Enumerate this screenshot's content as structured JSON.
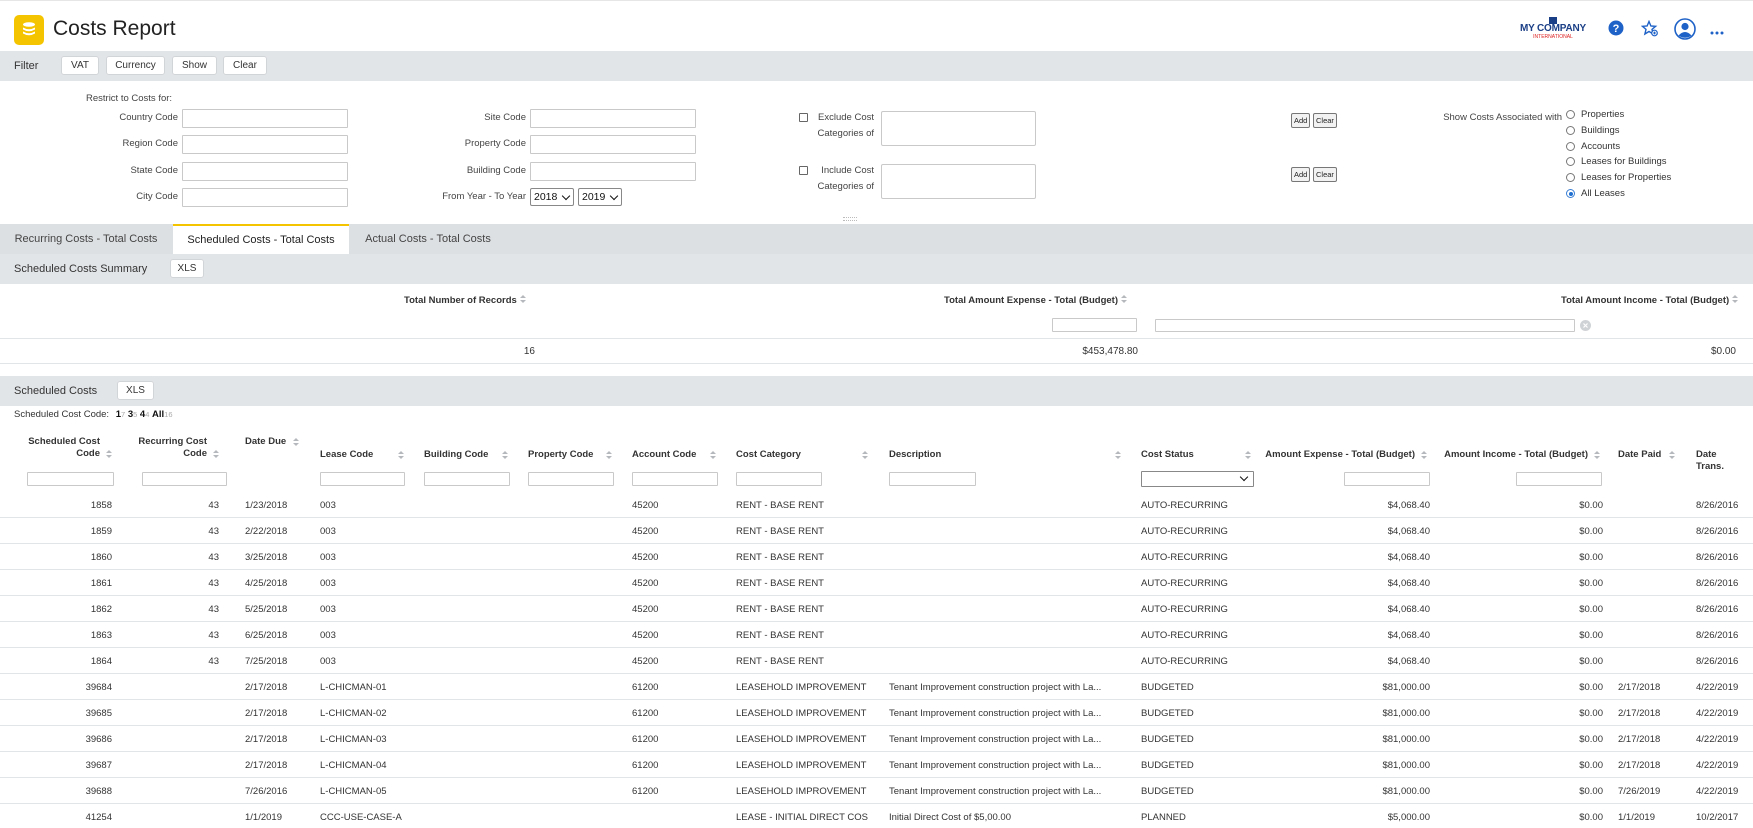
{
  "header": {
    "title": "Costs Report",
    "app_icon": "database-stack-icon",
    "brand": {
      "name": "MY COMPANY",
      "sub": "INTERNATIONAL"
    },
    "icons": [
      "help-icon",
      "favorite-star-icon",
      "user-avatar-icon",
      "more-menu-icon"
    ]
  },
  "filter_bar": {
    "label": "Filter",
    "buttons": [
      "VAT",
      "Currency",
      "Show",
      "Clear"
    ]
  },
  "filter_panel": {
    "restrict_label": "Restrict to Costs for:",
    "country_label": "Country Code",
    "region_label": "Region Code",
    "state_label": "State Code",
    "city_label": "City Code",
    "site_label": "Site Code",
    "property_label": "Property Code",
    "building_label": "Building Code",
    "year_label": "From Year - To Year",
    "from_year": "2018",
    "to_year": "2019",
    "exclude_label_1": "Exclude Cost",
    "exclude_label_2": "Categories of",
    "include_label_1": "Include Cost",
    "include_label_2": "Categories of",
    "add_label": "Add",
    "clear_label": "Clear",
    "show_assoc_label": "Show Costs Associated with",
    "assoc_options": [
      "Properties",
      "Buildings",
      "Accounts",
      "Leases for Buildings",
      "Leases for Properties",
      "All Leases"
    ],
    "assoc_selected": "All Leases"
  },
  "tabs": [
    "Recurring Costs - Total Costs",
    "Scheduled Costs - Total Costs",
    "Actual Costs - Total Costs"
  ],
  "active_tab": "Scheduled Costs - Total Costs",
  "summary": {
    "title": "Scheduled Costs Summary",
    "xls": "XLS",
    "headers": [
      "Total Number of Records",
      "Total Amount Expense - Total (Budget)",
      "Total Amount Income - Total (Budget)"
    ],
    "values": [
      "16",
      "$453,478.80",
      "$0.00"
    ]
  },
  "grid": {
    "title": "Scheduled Costs",
    "xls": "XLS",
    "pager": {
      "label": "Scheduled Cost Code:",
      "items": [
        {
          "label": "1",
          "count": "7"
        },
        {
          "label": "3",
          "count": "5"
        },
        {
          "label": "4",
          "count": "4"
        },
        {
          "label": "All",
          "count": "16"
        }
      ]
    },
    "columns": [
      "Scheduled Cost Code",
      "Recurring Cost Code",
      "Date Due",
      "Lease Code",
      "Building Code",
      "Property Code",
      "Account Code",
      "Cost Category",
      "Description",
      "Cost Status",
      "Amount Expense - Total (Budget)",
      "Amount Income - Total (Budget)",
      "Date Paid",
      "Date Trans."
    ],
    "rows": [
      [
        "1858",
        "43",
        "1/23/2018",
        "003",
        "",
        "",
        "45200",
        "RENT - BASE RENT",
        "",
        "AUTO-RECURRING",
        "$4,068.40",
        "$0.00",
        "",
        "8/26/2016"
      ],
      [
        "1859",
        "43",
        "2/22/2018",
        "003",
        "",
        "",
        "45200",
        "RENT - BASE RENT",
        "",
        "AUTO-RECURRING",
        "$4,068.40",
        "$0.00",
        "",
        "8/26/2016"
      ],
      [
        "1860",
        "43",
        "3/25/2018",
        "003",
        "",
        "",
        "45200",
        "RENT - BASE RENT",
        "",
        "AUTO-RECURRING",
        "$4,068.40",
        "$0.00",
        "",
        "8/26/2016"
      ],
      [
        "1861",
        "43",
        "4/25/2018",
        "003",
        "",
        "",
        "45200",
        "RENT - BASE RENT",
        "",
        "AUTO-RECURRING",
        "$4,068.40",
        "$0.00",
        "",
        "8/26/2016"
      ],
      [
        "1862",
        "43",
        "5/25/2018",
        "003",
        "",
        "",
        "45200",
        "RENT - BASE RENT",
        "",
        "AUTO-RECURRING",
        "$4,068.40",
        "$0.00",
        "",
        "8/26/2016"
      ],
      [
        "1863",
        "43",
        "6/25/2018",
        "003",
        "",
        "",
        "45200",
        "RENT - BASE RENT",
        "",
        "AUTO-RECURRING",
        "$4,068.40",
        "$0.00",
        "",
        "8/26/2016"
      ],
      [
        "1864",
        "43",
        "7/25/2018",
        "003",
        "",
        "",
        "45200",
        "RENT - BASE RENT",
        "",
        "AUTO-RECURRING",
        "$4,068.40",
        "$0.00",
        "",
        "8/26/2016"
      ],
      [
        "39684",
        "",
        "2/17/2018",
        "L-CHICMAN-01",
        "",
        "",
        "61200",
        "LEASEHOLD IMPROVEMENT",
        "Tenant Improvement construction project with La...",
        "BUDGETED",
        "$81,000.00",
        "$0.00",
        "2/17/2018",
        "4/22/2019"
      ],
      [
        "39685",
        "",
        "2/17/2018",
        "L-CHICMAN-02",
        "",
        "",
        "61200",
        "LEASEHOLD IMPROVEMENT",
        "Tenant Improvement construction project with La...",
        "BUDGETED",
        "$81,000.00",
        "$0.00",
        "2/17/2018",
        "4/22/2019"
      ],
      [
        "39686",
        "",
        "2/17/2018",
        "L-CHICMAN-03",
        "",
        "",
        "61200",
        "LEASEHOLD IMPROVEMENT",
        "Tenant Improvement construction project with La...",
        "BUDGETED",
        "$81,000.00",
        "$0.00",
        "2/17/2018",
        "4/22/2019"
      ],
      [
        "39687",
        "",
        "2/17/2018",
        "L-CHICMAN-04",
        "",
        "",
        "61200",
        "LEASEHOLD IMPROVEMENT",
        "Tenant Improvement construction project with La...",
        "BUDGETED",
        "$81,000.00",
        "$0.00",
        "2/17/2018",
        "4/22/2019"
      ],
      [
        "39688",
        "",
        "7/26/2016",
        "L-CHICMAN-05",
        "",
        "",
        "61200",
        "LEASEHOLD IMPROVEMENT",
        "Tenant Improvement construction project with La...",
        "BUDGETED",
        "$81,000.00",
        "$0.00",
        "7/26/2019",
        "4/22/2019"
      ],
      [
        "41254",
        "",
        "1/1/2019",
        "CCC-USE-CASE-A",
        "",
        "",
        "",
        "LEASE - INITIAL DIRECT COSTS",
        "Initial Direct Cost of $5,00.00",
        "PLANNED",
        "$5,000.00",
        "$0.00",
        "1/1/2019",
        "10/2/2017"
      ]
    ]
  },
  "colors": {
    "accent": "#f5c400",
    "brand": "#1b3f86",
    "bar_bg": "#e2e5e8",
    "help_blue": "#1f62c7"
  }
}
